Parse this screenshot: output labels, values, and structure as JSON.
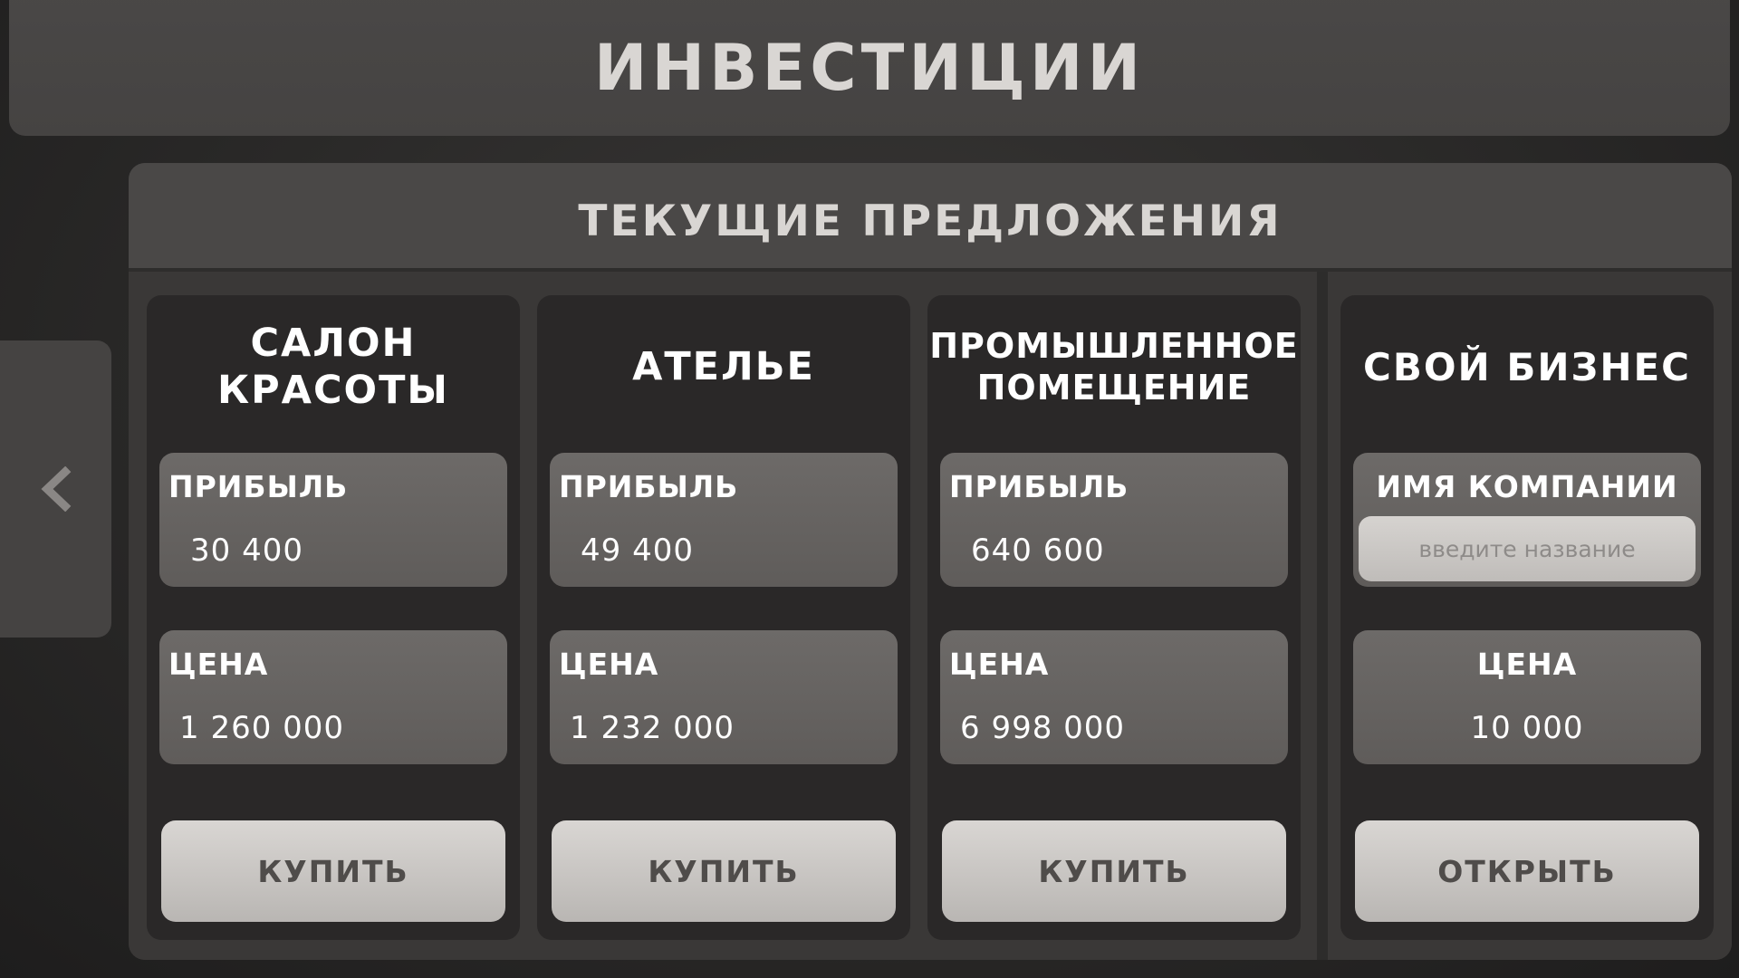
{
  "header": {
    "title": "ИНВЕСТИЦИИ"
  },
  "nav": {
    "back_icon": "chevron-left-icon"
  },
  "offers": {
    "title": "ТЕКУЩИЕ ПРЕДЛОЖЕНИЯ",
    "cards": [
      {
        "title_line1": "САЛОН",
        "title_line2": "КРАСОТЫ",
        "profit_label": "ПРИБЫЛЬ",
        "profit_value": "30 400",
        "price_label": "ЦЕНА",
        "price_value": "1 260 000",
        "button_label": "КУПИТЬ"
      },
      {
        "title_line1": "АТЕЛЬЕ",
        "title_line2": "",
        "profit_label": "ПРИБЫЛЬ",
        "profit_value": "49 400",
        "price_label": "ЦЕНА",
        "price_value": "1 232 000",
        "button_label": "КУПИТЬ"
      },
      {
        "title_line1": "ПРОМЫШЛЕННОЕ",
        "title_line2": "ПОМЕЩЕНИЕ",
        "profit_label": "ПРИБЫЛЬ",
        "profit_value": "640 600",
        "price_label": "ЦЕНА",
        "price_value": "6 998 000",
        "button_label": "КУПИТЬ"
      }
    ]
  },
  "own_business": {
    "title": "СВОЙ БИЗНЕС",
    "name_label": "ИМЯ КОМПАНИИ",
    "name_placeholder": "введите название",
    "name_value": "",
    "price_label": "ЦЕНА",
    "price_value": "10 000",
    "button_label": "ОТКРЫТЬ"
  },
  "colors": {
    "background": "#2a2928",
    "panel": "#4a4847",
    "card": "#2a2828",
    "stat_box": "#6d6a68",
    "button": "#d9d6d3",
    "button_text": "#4f4c4a",
    "title_text": "#d9d6d3"
  }
}
